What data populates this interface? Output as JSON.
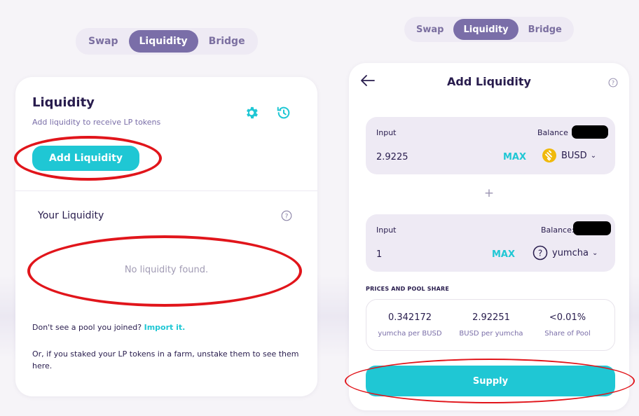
{
  "left": {
    "tabs": [
      "Swap",
      "Liquidity",
      "Bridge"
    ],
    "active_tab": "Liquidity",
    "title": "Liquidity",
    "subtitle": "Add liquidity to receive LP tokens",
    "add_button": "Add Liquidity",
    "your_liquidity": "Your Liquidity",
    "empty_text": "No liquidity found.",
    "import_prefix": "Don't see a pool you joined?",
    "import_link": "Import it.",
    "staked_text": "Or, if you staked your LP tokens in a farm, unstake them to see them here."
  },
  "right": {
    "tabs": [
      "Swap",
      "Liquidity",
      "Bridge"
    ],
    "active_tab": "Liquidity",
    "title": "Add Liquidity",
    "inputs": [
      {
        "label": "Input",
        "balance_label": "Balance",
        "amount": "2.9225",
        "max": "MAX",
        "token": "BUSD",
        "token_icon": "busd-coin-icon"
      },
      {
        "label": "Input",
        "balance_label": "Balance:",
        "amount": "1",
        "max": "MAX",
        "token": "yumcha",
        "token_icon": "question-circle-icon"
      }
    ],
    "plus": "+",
    "prices_title": "PRICES AND POOL SHARE",
    "prices": [
      {
        "value": "0.342172",
        "label": "yumcha per BUSD"
      },
      {
        "value": "2.92251",
        "label": "BUSD per yumcha"
      },
      {
        "value": "<0.01%",
        "label": "Share of Pool"
      }
    ],
    "supply_button": "Supply"
  },
  "colors": {
    "primary": "#1fc7d4",
    "secondary": "#7a6ea8",
    "text": "#281c4d",
    "annotation": "#e1151b",
    "input_bg": "#eeeaf4"
  }
}
